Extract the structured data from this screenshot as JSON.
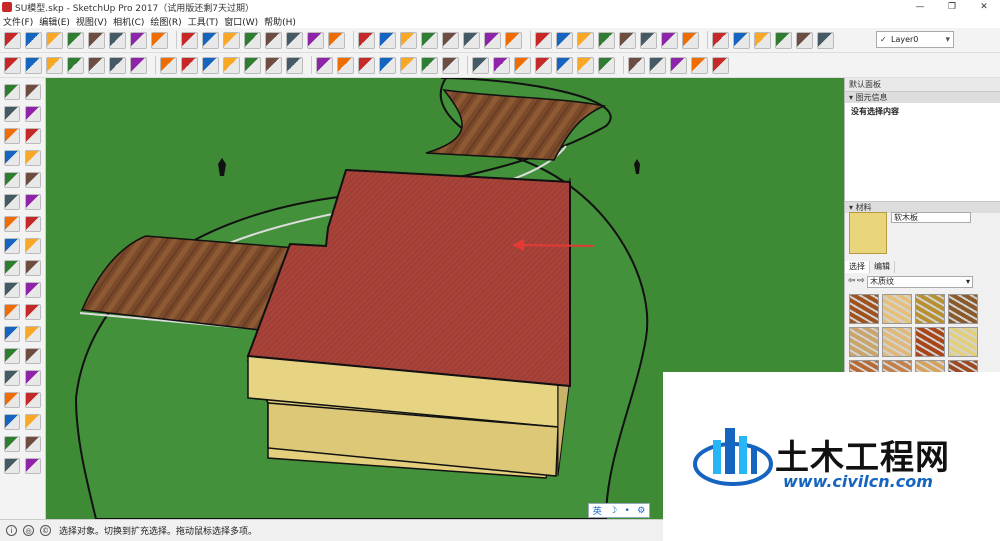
{
  "window": {
    "title": "SU模型.skp - SketchUp Pro 2017（试用版还剩7天过期）",
    "controls": {
      "minimize": "—",
      "maximize": "❐",
      "close": "✕"
    }
  },
  "menu": [
    "文件(F)",
    "编辑(E)",
    "视图(V)",
    "相机(C)",
    "绘图(R)",
    "工具(T)",
    "窗口(W)",
    "帮助(H)"
  ],
  "toolbar": {
    "layer_value": "Layer0",
    "row1_icons": [
      "select-icon",
      "make-component-icon",
      "paint-bucket-icon",
      "eraser-icon",
      "pencil-icon",
      "line-icon",
      "rectangle-icon",
      "rotated-rectangle-icon",
      "circle-icon",
      "polygon-icon",
      "arc-icon",
      "two-point-arc-icon",
      "three-point-arc-icon",
      "pie-icon",
      "move-icon",
      "rotate-icon",
      "follow-me-icon",
      "scale-icon",
      "offset-icon",
      "push-pull-icon",
      "tape-measure-icon",
      "dimension-icon",
      "protractor-icon",
      "text-icon",
      "axes-icon",
      "3d-text-icon",
      "orbit-icon",
      "pan-icon",
      "zoom-icon",
      "zoom-window-icon",
      "zoom-extents-icon",
      "previous-view-icon",
      "position-camera-icon",
      "look-around-icon",
      "walk-icon",
      "section-plane-icon",
      "display-section-icon",
      "display-cuts-icon"
    ],
    "row2_icons": [
      "select-icon",
      "eraser-icon",
      "pencil-icon",
      "arc-icon",
      "rectangle-icon",
      "push-pull-icon",
      "move-icon",
      "rotate-icon",
      "offset-icon",
      "tape-measure-icon",
      "text-icon",
      "paint-icon",
      "orbit-icon",
      "pan-icon",
      "zoom-icon",
      "zoom-extents-icon",
      "warehouse-icon",
      "share-model-icon",
      "extension-icon",
      "ruby-icon",
      "xray-icon",
      "back-edges-icon",
      "wireframe-icon",
      "hidden-line-icon",
      "shaded-icon",
      "shaded-textures-icon",
      "monochrome-icon",
      "iso-view-icon",
      "top-view-icon",
      "front-view-icon",
      "right-view-icon",
      "back-view-icon",
      "left-view-icon"
    ]
  },
  "tray": {
    "title": "默认面板",
    "entity_info": {
      "header": "图元信息",
      "body": "没有选择内容"
    },
    "materials": {
      "header": "材料",
      "current_name": "软木板",
      "tabs": [
        "选择",
        "编辑"
      ],
      "library": "木质纹",
      "swatch_colors": [
        "#a0521e",
        "#e6c07a",
        "#b8902f",
        "#8b5a2b",
        "#c9a56b",
        "#e0b97a",
        "#a8461a",
        "#e3cf7a",
        "#b96a33",
        "#c4804a",
        "#d6a35e",
        "#9c4a22"
      ]
    }
  },
  "status": {
    "text": "选择对象。切换到扩充选择。拖动鼠标选择多项。",
    "icons": [
      "info-icon",
      "geo-location-icon",
      "credits-icon"
    ]
  },
  "ime": {
    "lang": "英",
    "moon": "☽",
    "dot": "•",
    "gear": "⚙"
  },
  "watermark": {
    "name": "土木工程网",
    "url": "www.civilcn.com"
  },
  "colors": {
    "grass": "#3f8a35",
    "roof": "#a8433a",
    "wall": "#e7d483",
    "wood": "#7a4a2a",
    "arrow": "#e53935"
  }
}
